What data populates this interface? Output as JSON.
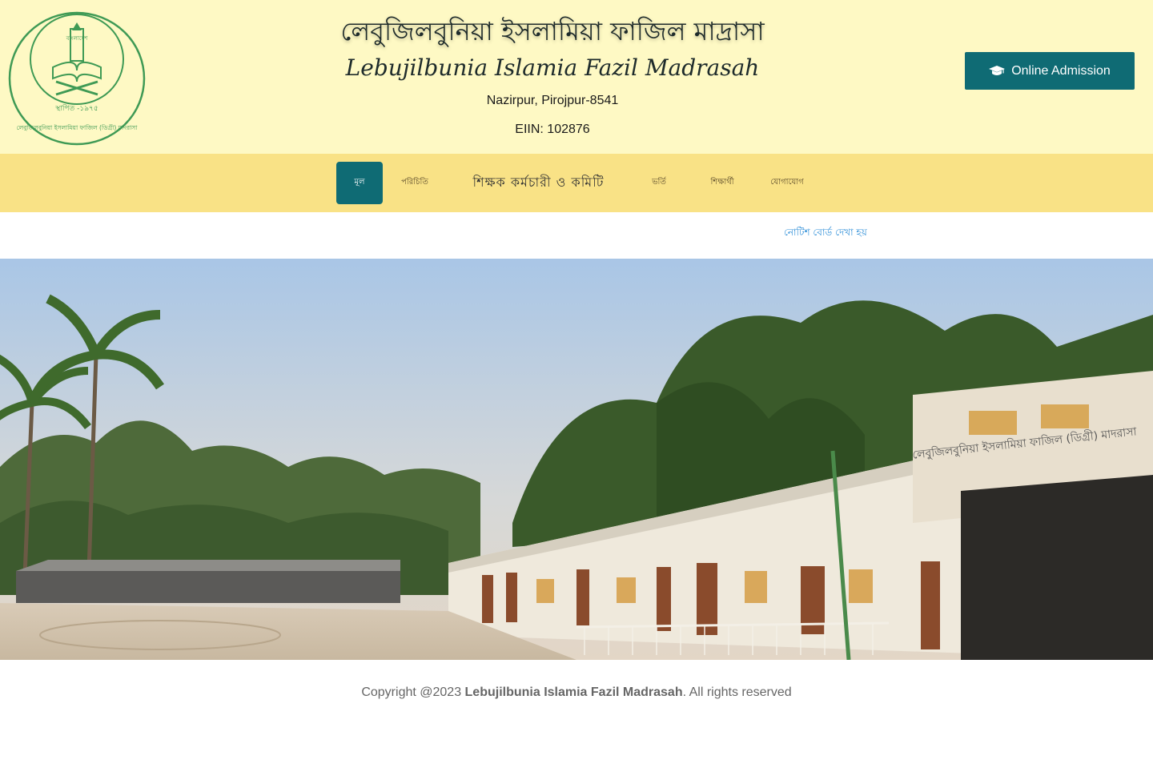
{
  "header": {
    "title_bn": "লেবুজিলবুনিয়া ইসলামিয়া ফাজিল মাদ্রাসা",
    "title_en": "Lebujilbunia Islamia Fazil Madrasah",
    "address": "Nazirpur, Pirojpur-8541",
    "eiin": "EIIN: 102876",
    "admission_label": "Online Admission",
    "admission_icon": "graduation-cap-icon",
    "logo": {
      "arc_text_top": "বাংলাদেশ",
      "established_text": "স্থাপিত -১৯৭৫",
      "arc_text_bottom": "লেবুজিলবুনিয়া ইসলামিয়া ফাজিল (ডিগ্রী) মাদরাসা"
    }
  },
  "nav": {
    "items": [
      {
        "label": "মূল",
        "active": true
      },
      {
        "label": "পরিচিতি",
        "active": false
      },
      {
        "label": "শিক্ষক কর্মচারী ও কমিটি",
        "active": false
      },
      {
        "label": "ভর্তি",
        "active": false
      },
      {
        "label": "শিক্ষার্থী",
        "active": false
      },
      {
        "label": "যোগাযোগ",
        "active": false
      }
    ]
  },
  "notice": {
    "text": "নোটিশ বোর্ড দেখা হয়"
  },
  "hero": {
    "sign_text": "লেবুজিলবুনিয়া ইসলামিয়া ফাজিল (ডিগ্রী) মাদরাসা"
  },
  "footer": {
    "prefix": "Copyright @2023 ",
    "name": "Lebujilbunia Islamia Fazil Madrasah",
    "suffix": ". All rights reserved"
  },
  "colors": {
    "header_bg": "#fef9c4",
    "nav_bg": "#f9e286",
    "accent": "#0f6b74",
    "notice": "#2f8fd8"
  }
}
